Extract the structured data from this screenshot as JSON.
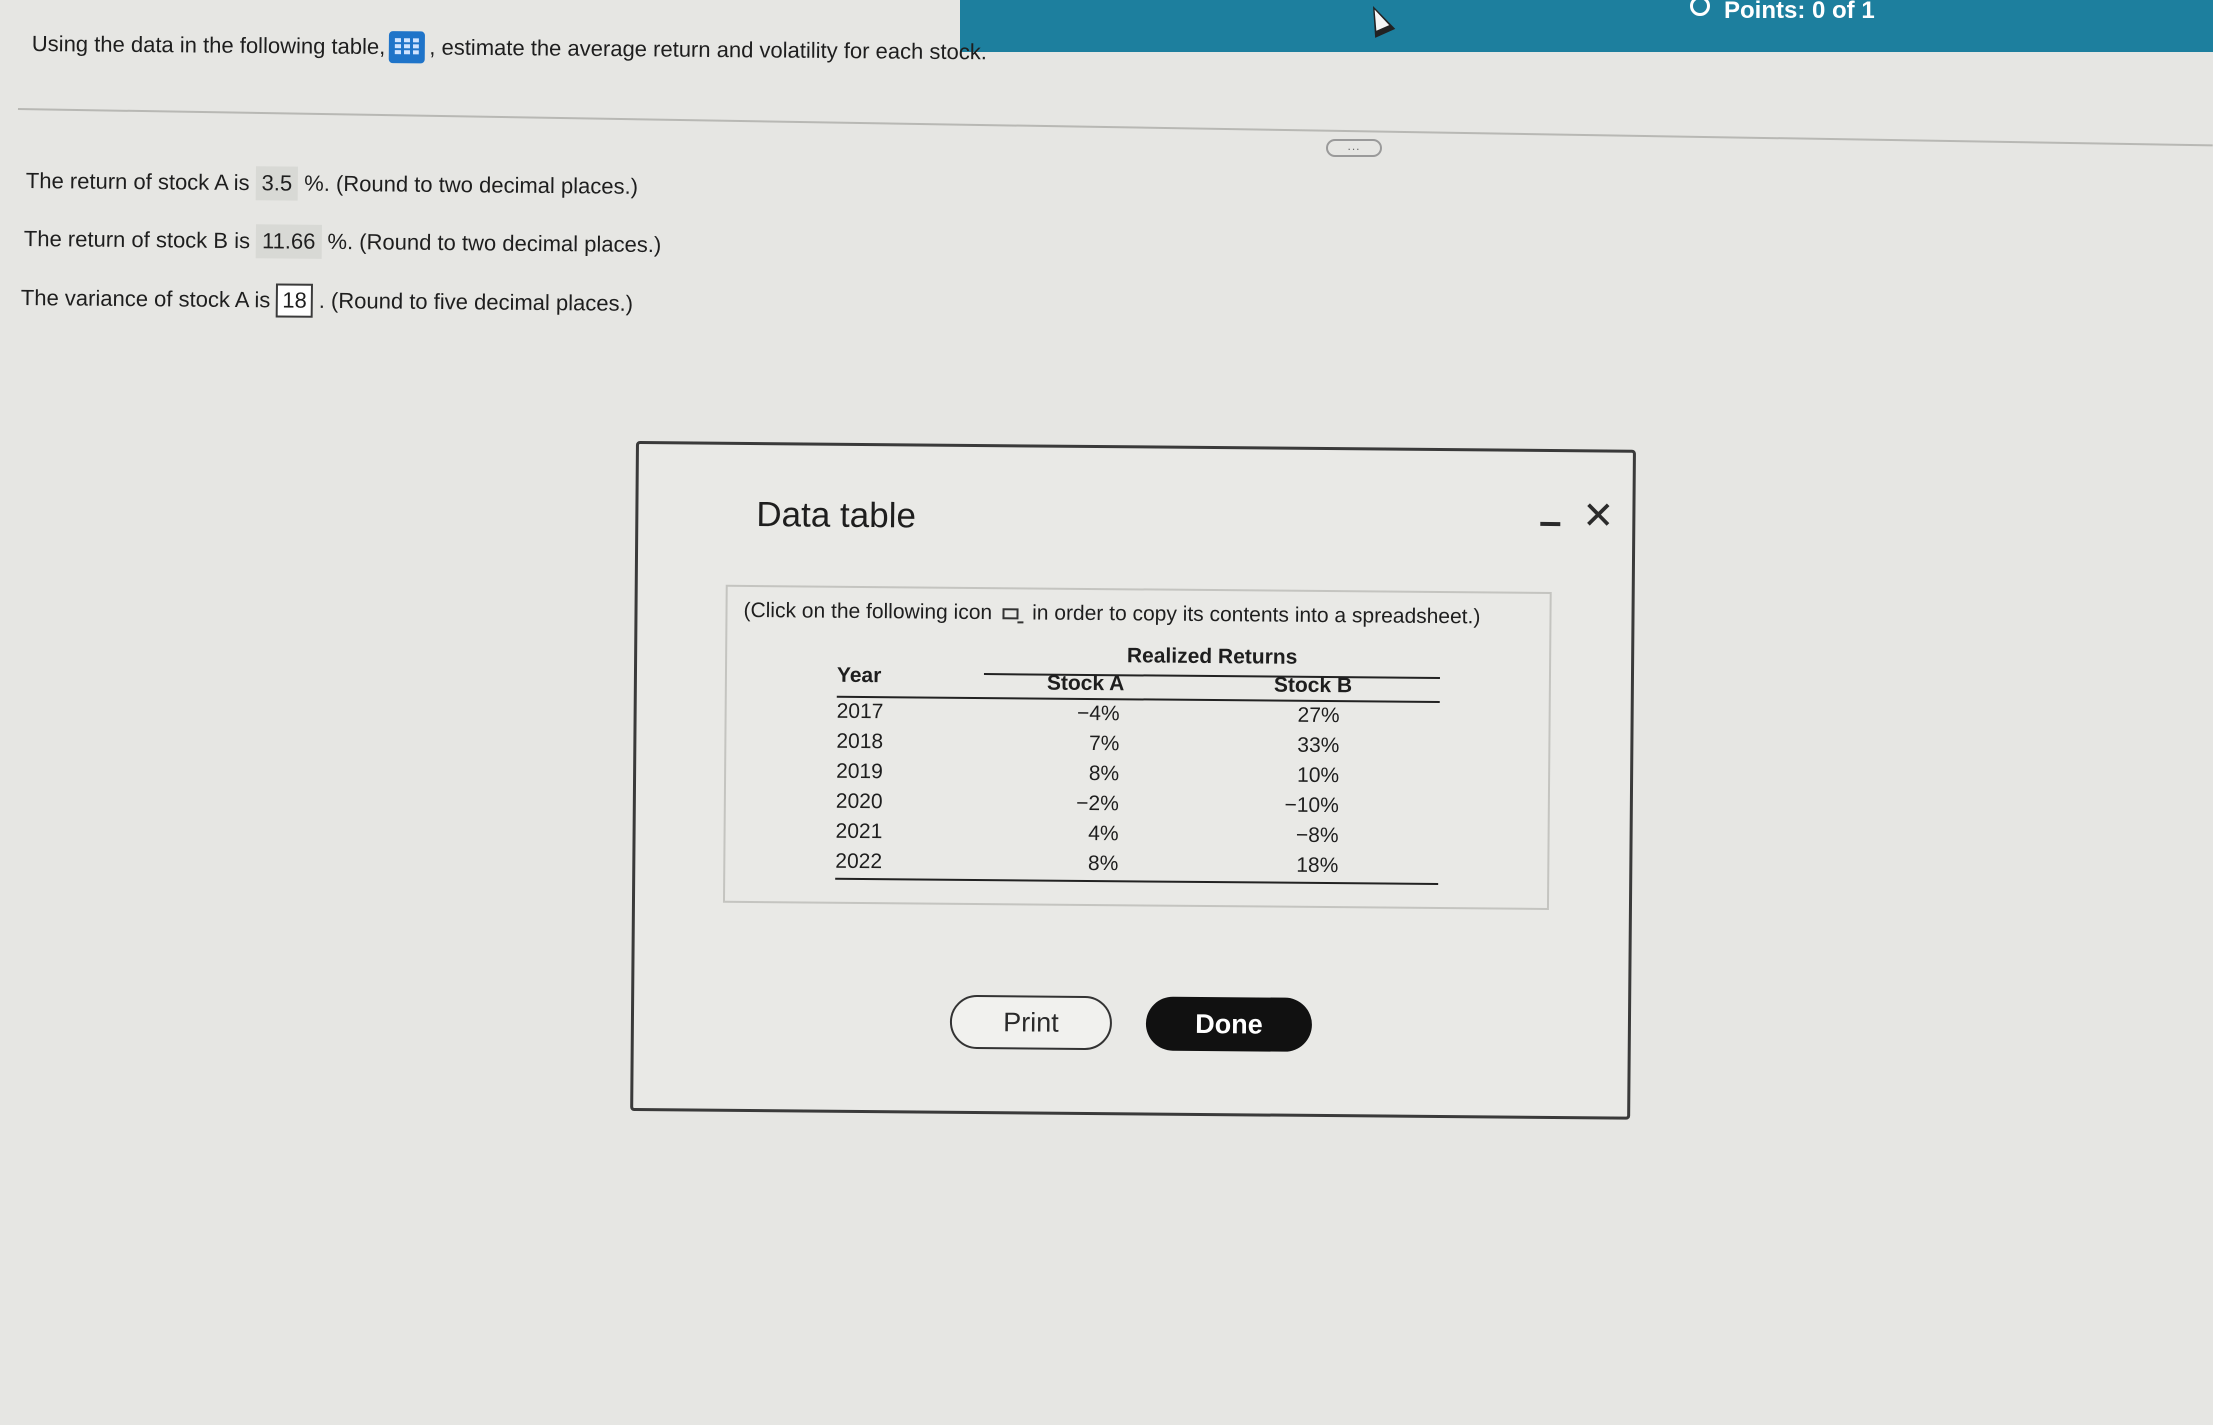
{
  "header": {
    "points_label": "Points: 0 of 1"
  },
  "question": {
    "prefix": "Using the data in the following table,",
    "suffix": ", estimate the average return and volatility for each stock.",
    "table_icon": "grid-icon"
  },
  "more_label": "...",
  "answers": [
    {
      "before": "The return of stock A is",
      "value": "3.5",
      "after": "%.  (Round to two decimal places.)"
    },
    {
      "before": "The return of stock B is",
      "value": "11.66",
      "after": "%.  (Round to two decimal places.)"
    },
    {
      "before": "The variance of stock A is",
      "value": "18",
      "after": ".  (Round to five decimal places.)"
    }
  ],
  "dialog": {
    "title": "Data table",
    "minimize_icon": "minimize-icon",
    "close_icon": "close-icon",
    "close_glyph": "✕",
    "copy_note_before": "(Click on the following icon",
    "copy_note_after": "in order to copy its contents into a spreadsheet.)",
    "table": {
      "group_header": "Realized Returns",
      "columns": [
        "Year",
        "Stock A",
        "Stock B"
      ],
      "rows": [
        {
          "year": "2017",
          "a": "−4%",
          "b": "27%"
        },
        {
          "year": "2018",
          "a": "7%",
          "b": "33%"
        },
        {
          "year": "2019",
          "a": "8%",
          "b": "10%"
        },
        {
          "year": "2020",
          "a": "−2%",
          "b": "−10%"
        },
        {
          "year": "2021",
          "a": "4%",
          "b": "−8%"
        },
        {
          "year": "2022",
          "a": "8%",
          "b": "18%"
        }
      ]
    },
    "print_label": "Print",
    "done_label": "Done"
  },
  "colors": {
    "banner": "#1d7f9e",
    "table_icon_blue": "#1f74c9",
    "done_button": "#111111"
  }
}
